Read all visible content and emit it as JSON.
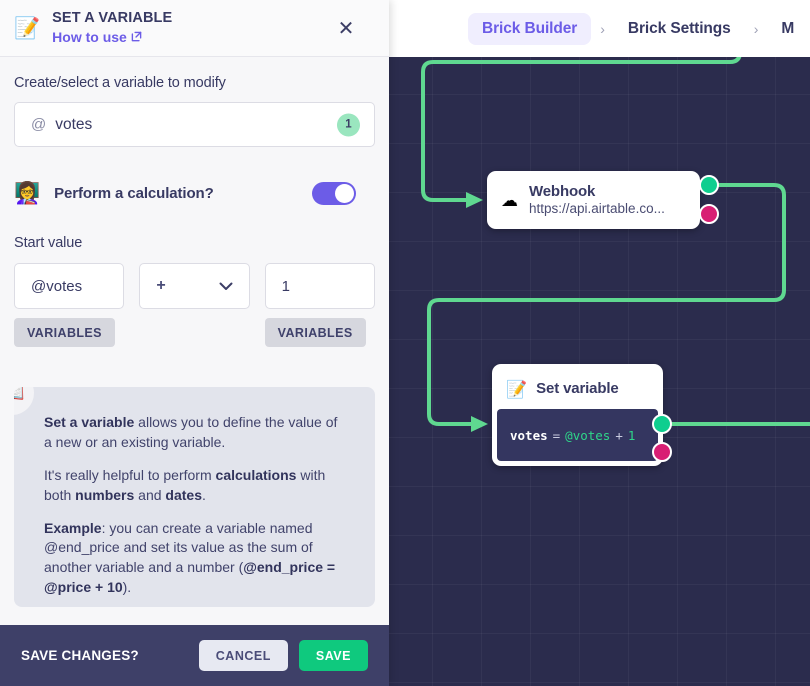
{
  "panel": {
    "emoji": "📝",
    "title": "SET A VARIABLE",
    "how_to_use": "How to use",
    "close_label": "✕",
    "variable_section_label": "Create/select a variable to modify",
    "variable_value": "votes",
    "variable_at": "@",
    "variable_badge": "1",
    "calculation_emoji": "👩‍🏫",
    "calculation_label": "Perform a calculation?",
    "calculation_toggle_on": true,
    "start_value_label": "Start value",
    "start_value": "@votes",
    "operator": "+",
    "operand_value": "1",
    "variables_button_left": "VARIABLES",
    "variables_button_right": "VARIABLES",
    "help": {
      "emoji": "📖",
      "p1_bold": "Set a variable",
      "p1_rest": " allows you to define the value of a new or an existing variable.",
      "p2_a": "It's really helpful to perform ",
      "p2_b": "calculations",
      "p2_c": " with both ",
      "p2_d": "numbers",
      "p2_e": " and ",
      "p2_f": "dates",
      "p2_g": ".",
      "p3_bold": "Example",
      "p3_a": ": you can create a variable named @end_price and set its value as the sum of another variable and a number (",
      "p3_b": "@end_price = @price + 10",
      "p3_c": ")."
    }
  },
  "savebar": {
    "label": "SAVE CHANGES?",
    "cancel": "CANCEL",
    "save": "SAVE"
  },
  "breadcrumb": {
    "items": [
      {
        "label": "Brick Builder",
        "active": true
      },
      {
        "label": "Brick Settings",
        "active": false
      },
      {
        "label": "M",
        "active": false
      }
    ],
    "separator": "›"
  },
  "canvas": {
    "nodes": [
      {
        "id": "webhook",
        "icon": "☁",
        "title": "Webhook",
        "subtitle": "https://api.airtable.co...",
        "port_success_color": "#0fce8f",
        "port_error_color": "#d81f74"
      },
      {
        "id": "set-variable",
        "icon": "📝",
        "title": "Set variable",
        "expression": {
          "variable": "votes",
          "equals": "=",
          "reference": "@votes",
          "operator": "+",
          "operand": "1"
        },
        "port_success_color": "#0fce8f",
        "port_error_color": "#d81f74"
      }
    ],
    "background_color": "#2b2c4d",
    "wire_color": "#5fd890"
  },
  "colors": {
    "accent_purple": "#6c5ce7",
    "green": "#0fc97e",
    "pink": "#d81f74",
    "dark_navy": "#3e4068"
  }
}
